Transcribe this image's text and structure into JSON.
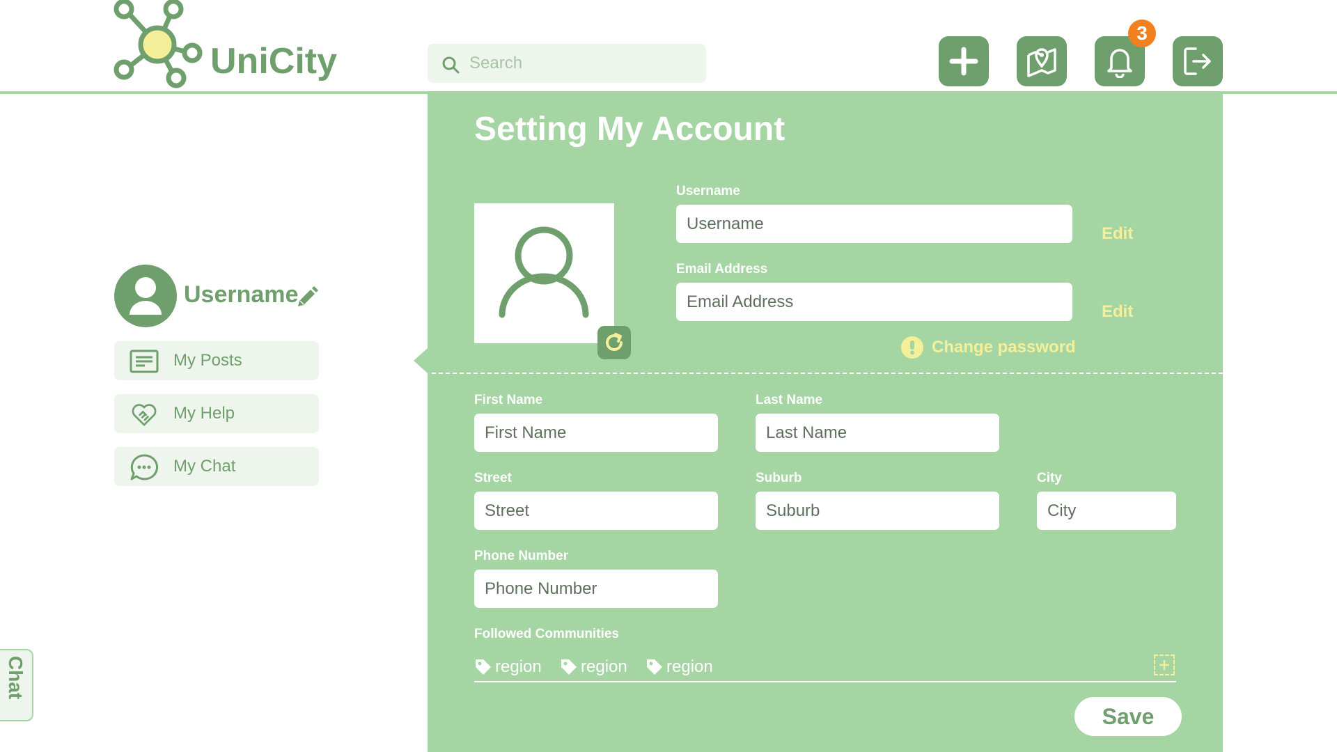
{
  "brand": {
    "name": "UniCity"
  },
  "header": {
    "search_placeholder": "Search",
    "notification_count": "3",
    "buttons": [
      "add-icon",
      "map-icon",
      "bell-icon",
      "logout-icon"
    ]
  },
  "sidebar": {
    "username": "Username",
    "items": [
      {
        "label": "My Posts",
        "icon": "posts-icon"
      },
      {
        "label": "My Help",
        "icon": "handshake-heart-icon"
      },
      {
        "label": "My Chat",
        "icon": "chat-bubble-icon"
      }
    ],
    "chat_tab": "Chat"
  },
  "main": {
    "title": "Setting My Account",
    "username": {
      "label": "Username",
      "placeholder": "Username",
      "edit": "Edit"
    },
    "email": {
      "label": "Email Address",
      "placeholder": "Email Address",
      "edit": "Edit"
    },
    "change_password": "Change password",
    "first_name": {
      "label": "First Name",
      "placeholder": "First Name"
    },
    "last_name": {
      "label": "Last Name",
      "placeholder": "Last Name"
    },
    "street": {
      "label": "Street",
      "placeholder": "Street"
    },
    "suburb": {
      "label": "Suburb",
      "placeholder": "Suburb"
    },
    "city": {
      "label": "City",
      "placeholder": "City"
    },
    "phone": {
      "label": "Phone Number",
      "placeholder": "Phone Number"
    },
    "followed_communities": {
      "label": "Followed Communities",
      "tags": [
        "region",
        "region",
        "region"
      ]
    },
    "save": "Save"
  },
  "colors": {
    "accent": "#6f9f6c",
    "panel": "#a6d5a4",
    "highlight": "#f4f09a",
    "badge": "#f08020"
  }
}
